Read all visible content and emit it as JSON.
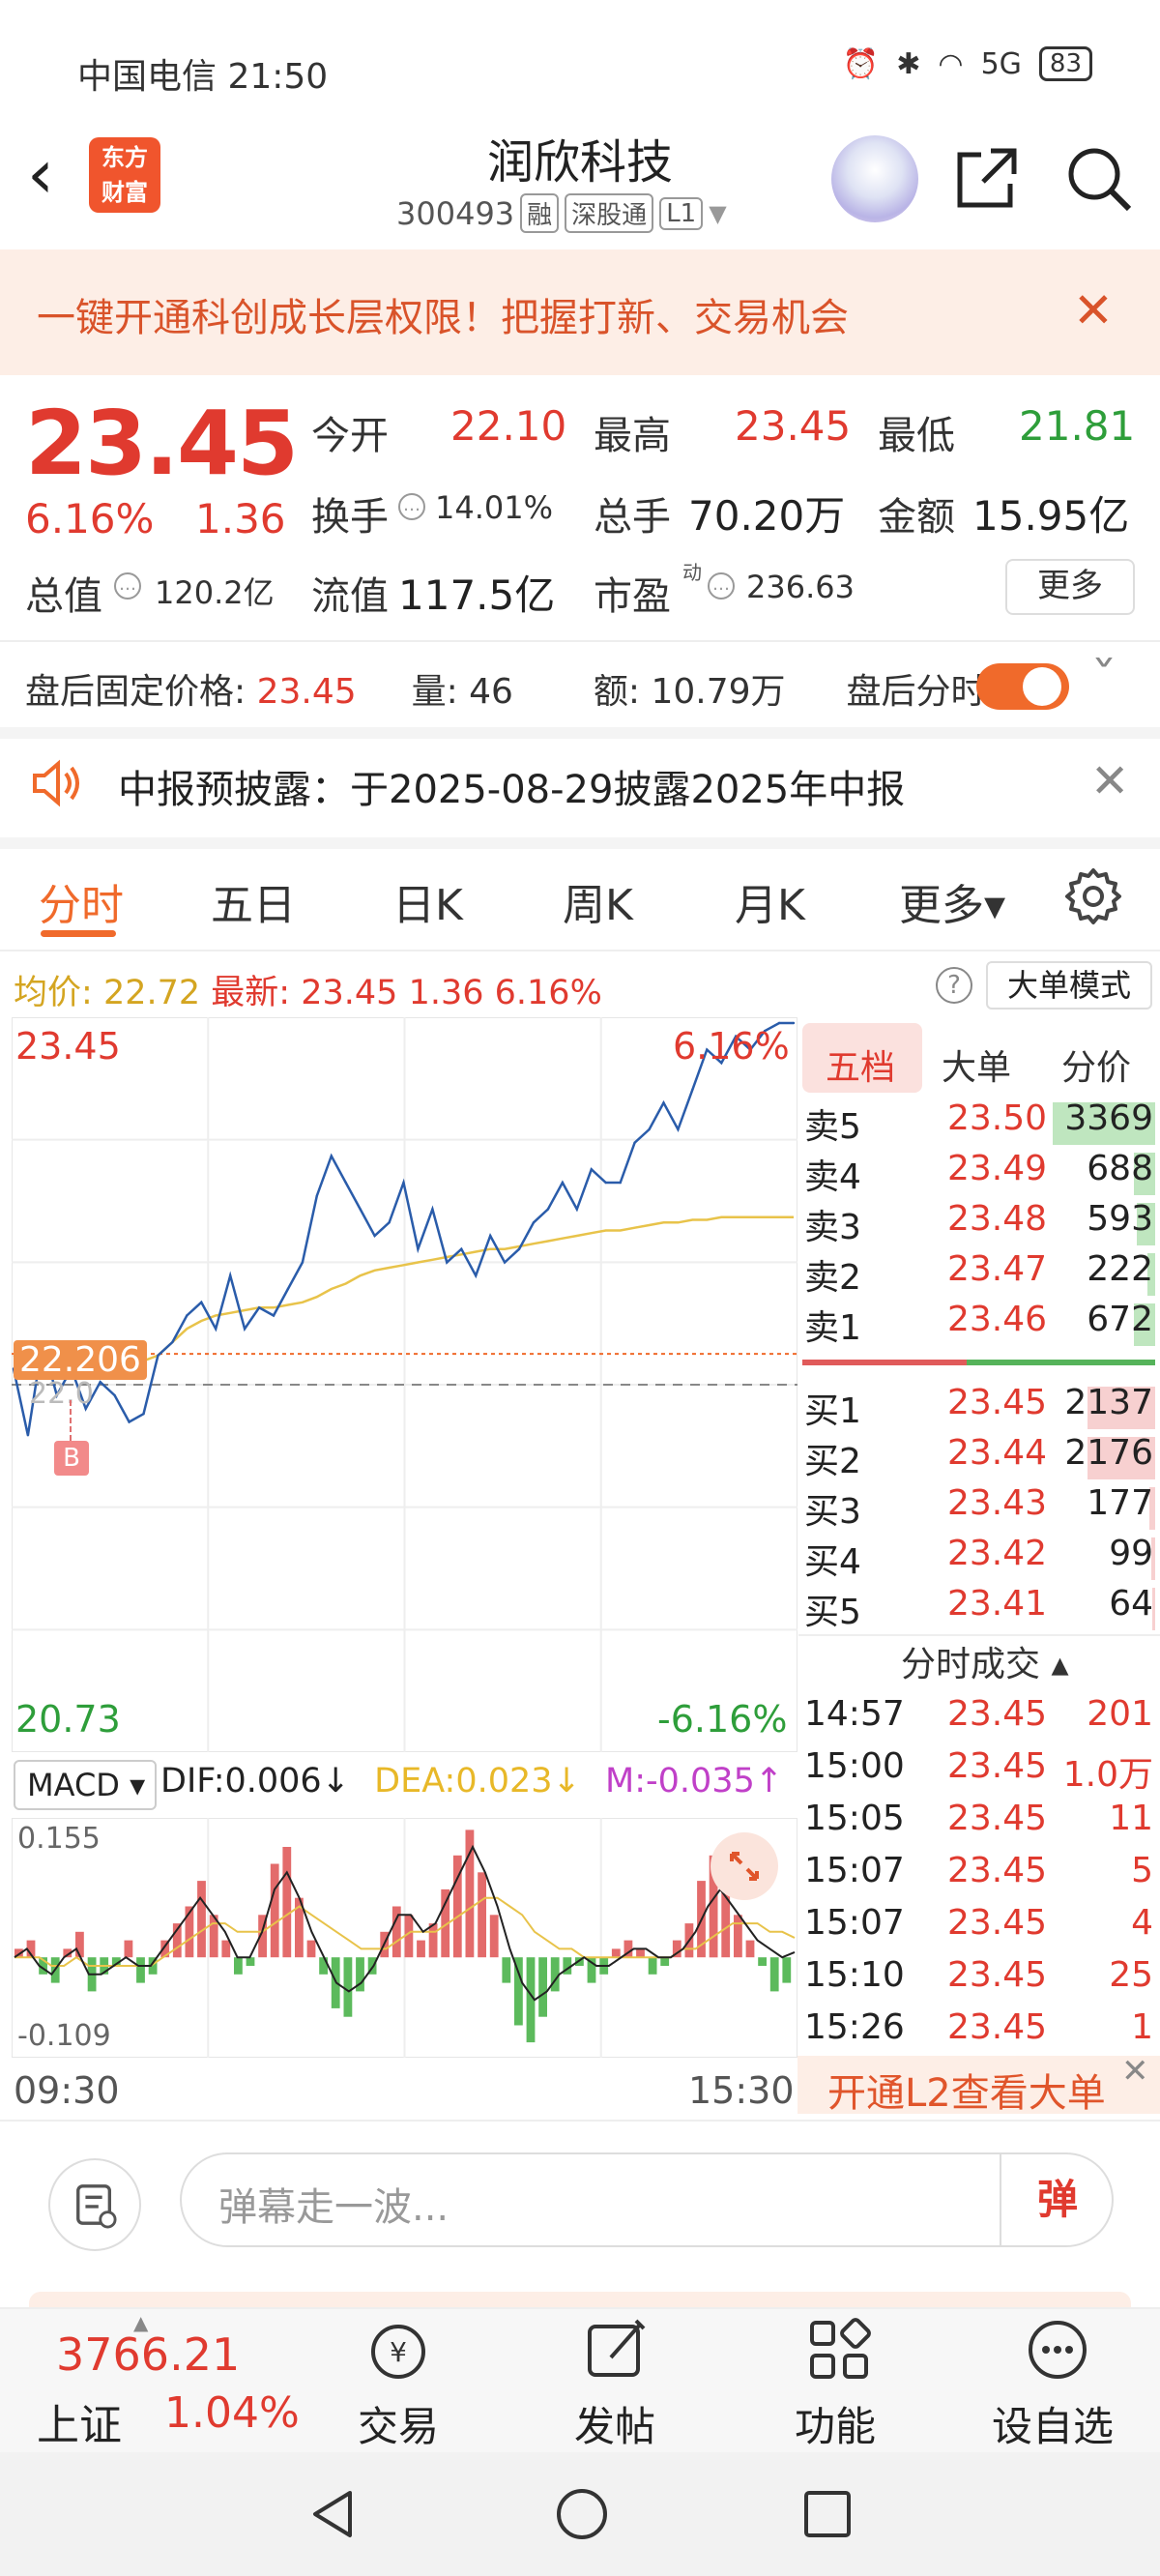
{
  "status_bar": {
    "carrier_time": "中国电信 21:50",
    "network": "5G",
    "battery": "83"
  },
  "header": {
    "logo_line1": "东方",
    "logo_line2": "财富",
    "title": "润欣科技",
    "code": "300493",
    "tags": [
      "融",
      "深股通",
      "L1"
    ]
  },
  "banner": {
    "text": "一键开通科创成长层权限！把握打新、交易机会"
  },
  "quote": {
    "price": "23.45",
    "pct": "6.16%",
    "change": "1.36",
    "open_label": "今开",
    "open": "22.10",
    "high_label": "最高",
    "high": "23.45",
    "low_label": "最低",
    "low": "21.81",
    "turnover_label": "换手",
    "turnover": "14.01%",
    "volume_label": "总手",
    "volume": "70.20万",
    "amount_label": "金额",
    "amount": "15.95亿",
    "mktcap_label": "总值",
    "mktcap": "120.2亿",
    "float_label": "流值",
    "float": "117.5亿",
    "pe_label": "市盈",
    "pe_sup": "动",
    "pe": "236.63",
    "more_btn": "更多"
  },
  "after_hours": {
    "price_label": "盘后固定价格:",
    "price": "23.45",
    "vol_label": "量:",
    "vol": "46",
    "amt_label": "额:",
    "amt": "10.79万",
    "toggle_label": "盘后分时"
  },
  "notice": {
    "text": "中报预披露：于2025-08-29披露2025年中报"
  },
  "tabs": [
    "分时",
    "五日",
    "日K",
    "周K",
    "月K",
    "更多▾"
  ],
  "chart_head": {
    "avg_label": "均价:",
    "avg": "22.72",
    "last_label": "最新:",
    "last": "23.45",
    "chg": "1.36",
    "pct": "6.16%",
    "bigorder_btn": "大单模式"
  },
  "chart_labels": {
    "top_price": "23.45",
    "top_pct": "6.16%",
    "bottom_price": "20.73",
    "bottom_pct": "-6.16%",
    "cursor_price": "22.206",
    "base_price": "22.0",
    "buy_marker": "B",
    "time_start": "09:30",
    "time_end": "15:30"
  },
  "macd": {
    "selector": "MACD ▾",
    "dif": "DIF:0.006↓",
    "dea": "DEA:0.023↓",
    "m": "M:-0.035↑",
    "top": "0.155",
    "bottom": "-0.109"
  },
  "order_book": {
    "tabs": [
      "五档",
      "大单",
      "分价"
    ],
    "asks": [
      {
        "label": "卖5",
        "price": "23.50",
        "vol": "3369"
      },
      {
        "label": "卖4",
        "price": "23.49",
        "vol": "688"
      },
      {
        "label": "卖3",
        "price": "23.48",
        "vol": "593"
      },
      {
        "label": "卖2",
        "price": "23.47",
        "vol": "222"
      },
      {
        "label": "卖1",
        "price": "23.46",
        "vol": "672"
      }
    ],
    "bids": [
      {
        "label": "买1",
        "price": "23.45",
        "vol": "2137"
      },
      {
        "label": "买2",
        "price": "23.44",
        "vol": "2176"
      },
      {
        "label": "买3",
        "price": "23.43",
        "vol": "177"
      },
      {
        "label": "买4",
        "price": "23.42",
        "vol": "99"
      },
      {
        "label": "买5",
        "price": "23.41",
        "vol": "64"
      }
    ],
    "trades_title": "分时成交 ▴",
    "trades": [
      {
        "time": "14:57",
        "price": "23.45",
        "vol": "201"
      },
      {
        "time": "15:00",
        "price": "23.45",
        "vol": "1.0万"
      },
      {
        "time": "15:05",
        "price": "23.45",
        "vol": "11"
      },
      {
        "time": "15:07",
        "price": "23.45",
        "vol": "5"
      },
      {
        "time": "15:07",
        "price": "23.45",
        "vol": "4"
      },
      {
        "time": "15:10",
        "price": "23.45",
        "vol": "25"
      },
      {
        "time": "15:26",
        "price": "23.45",
        "vol": "1"
      }
    ],
    "l2_text": "开通L2查看大单"
  },
  "comment": {
    "placeholder": "弹幕走一波...",
    "danmu_btn": "弹"
  },
  "bottom_nav": {
    "index_value": "3766.21",
    "index_name": "上证",
    "index_pct": "1.04%",
    "items": [
      "交易",
      "发帖",
      "功能",
      "设自选"
    ]
  },
  "colors": {
    "up": "#e03a2f",
    "down": "#2e9e3a",
    "accent": "#f06a2b",
    "price_line": "#2a5caa",
    "avg_line": "#e8c34a"
  },
  "chart_data": {
    "type": "line",
    "title": "",
    "xlabel": "",
    "ylabel": "",
    "ylim": [
      20.73,
      23.45
    ],
    "x_range": [
      "09:30",
      "15:30"
    ],
    "series": [
      {
        "name": "最新",
        "values": [
          22.15,
          21.9,
          22.25,
          22.05,
          22.15,
          22.0,
          22.1,
          22.05,
          21.95,
          21.98,
          22.2,
          22.25,
          22.35,
          22.4,
          22.3,
          22.5,
          22.3,
          22.38,
          22.35,
          22.45,
          22.55,
          22.8,
          22.95,
          22.85,
          22.75,
          22.65,
          22.7,
          22.85,
          22.6,
          22.75,
          22.55,
          22.6,
          22.5,
          22.65,
          22.55,
          22.6,
          22.7,
          22.75,
          22.85,
          22.75,
          22.9,
          22.85,
          22.85,
          23.0,
          23.05,
          23.15,
          23.05,
          23.2,
          23.35,
          23.3,
          23.4,
          23.35,
          23.42,
          23.45,
          23.45
        ]
      },
      {
        "name": "均价",
        "values": [
          22.2,
          22.18,
          22.16,
          22.15,
          22.14,
          22.14,
          22.15,
          22.15,
          22.16,
          22.18,
          22.2,
          22.25,
          22.3,
          22.33,
          22.35,
          22.36,
          22.37,
          22.38,
          22.38,
          22.39,
          22.4,
          22.42,
          22.45,
          22.47,
          22.5,
          22.52,
          22.53,
          22.54,
          22.55,
          22.56,
          22.57,
          22.58,
          22.59,
          22.6,
          22.6,
          22.61,
          22.62,
          22.63,
          22.64,
          22.65,
          22.66,
          22.67,
          22.67,
          22.68,
          22.69,
          22.7,
          22.7,
          22.71,
          22.71,
          22.72,
          22.72,
          22.72,
          22.72,
          22.72,
          22.72
        ]
      }
    ],
    "macd": {
      "ylim": [
        -0.109,
        0.155
      ],
      "histogram": [
        0.01,
        0.02,
        -0.02,
        -0.03,
        0.01,
        0.03,
        -0.04,
        -0.02,
        -0.01,
        0.02,
        -0.03,
        -0.02,
        0.02,
        0.04,
        0.06,
        0.09,
        0.05,
        0.02,
        -0.02,
        -0.01,
        0.05,
        0.11,
        0.13,
        0.07,
        0.02,
        -0.02,
        -0.06,
        -0.07,
        -0.04,
        -0.02,
        0.03,
        0.06,
        0.05,
        0.02,
        0.04,
        0.08,
        0.12,
        0.15,
        0.1,
        0.05,
        -0.03,
        -0.08,
        -0.1,
        -0.07,
        -0.04,
        -0.02,
        -0.01,
        -0.03,
        -0.02,
        0.01,
        0.02,
        0.01,
        -0.02,
        -0.01,
        0.02,
        0.04,
        0.09,
        0.12,
        0.08,
        0.05,
        0.02,
        -0.01,
        -0.04,
        -0.03
      ],
      "dif": [
        0.0,
        0.01,
        -0.01,
        -0.02,
        0.0,
        0.01,
        -0.02,
        -0.02,
        -0.01,
        0.0,
        -0.01,
        -0.01,
        0.01,
        0.03,
        0.05,
        0.07,
        0.05,
        0.03,
        0.0,
        0.0,
        0.03,
        0.08,
        0.1,
        0.07,
        0.03,
        0.0,
        -0.03,
        -0.04,
        -0.03,
        -0.01,
        0.02,
        0.05,
        0.05,
        0.03,
        0.04,
        0.07,
        0.1,
        0.13,
        0.1,
        0.06,
        0.01,
        -0.03,
        -0.05,
        -0.04,
        -0.02,
        -0.01,
        0.0,
        -0.01,
        -0.01,
        0.0,
        0.01,
        0.01,
        0.0,
        0.0,
        0.01,
        0.03,
        0.06,
        0.08,
        0.06,
        0.04,
        0.02,
        0.01,
        0.0,
        0.006
      ],
      "dea": [
        0.0,
        0.0,
        0.0,
        -0.01,
        -0.01,
        0.0,
        -0.01,
        -0.01,
        -0.01,
        -0.01,
        -0.01,
        -0.01,
        0.0,
        0.01,
        0.02,
        0.03,
        0.04,
        0.04,
        0.03,
        0.03,
        0.03,
        0.04,
        0.05,
        0.06,
        0.05,
        0.04,
        0.03,
        0.02,
        0.01,
        0.01,
        0.01,
        0.02,
        0.03,
        0.03,
        0.03,
        0.04,
        0.05,
        0.06,
        0.07,
        0.07,
        0.06,
        0.05,
        0.03,
        0.02,
        0.01,
        0.01,
        0.0,
        0.0,
        0.0,
        0.0,
        0.0,
        0.0,
        0.0,
        0.0,
        0.01,
        0.01,
        0.02,
        0.03,
        0.04,
        0.04,
        0.04,
        0.03,
        0.03,
        0.023
      ]
    }
  }
}
